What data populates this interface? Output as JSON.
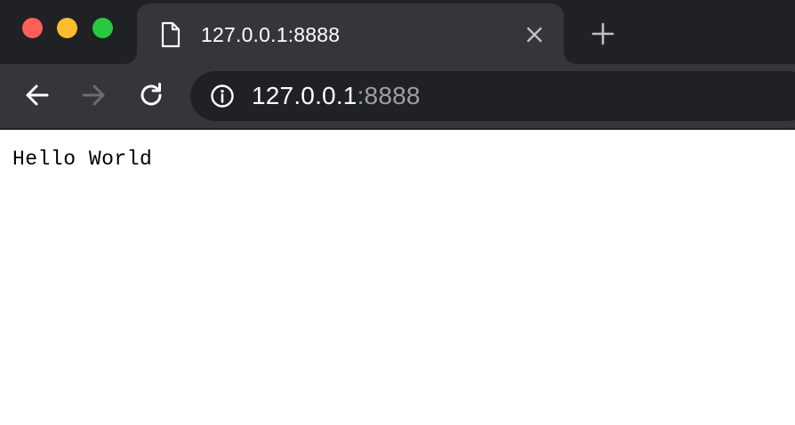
{
  "window": {
    "traffic_lights": {
      "close_color": "#fe5f57",
      "minimize_color": "#febc2e",
      "maximize_color": "#28c840"
    }
  },
  "tab": {
    "favicon_icon": "document-icon",
    "title": "127.0.0.1:8888",
    "close_icon": "close-icon"
  },
  "new_tab_icon": "plus-icon",
  "toolbar": {
    "back_icon": "arrow-left-icon",
    "forward_icon": "arrow-right-icon",
    "forward_enabled": false,
    "reload_icon": "reload-icon"
  },
  "omnibox": {
    "security_icon": "info-icon",
    "host": "127.0.0.1",
    "port": ":8888"
  },
  "page": {
    "content": "Hello World"
  },
  "colors": {
    "tabstrip_bg": "#202124",
    "active_tab_bg": "#35363a",
    "omnibox_bg": "#202124",
    "url_port_color": "#9aa0a6"
  }
}
